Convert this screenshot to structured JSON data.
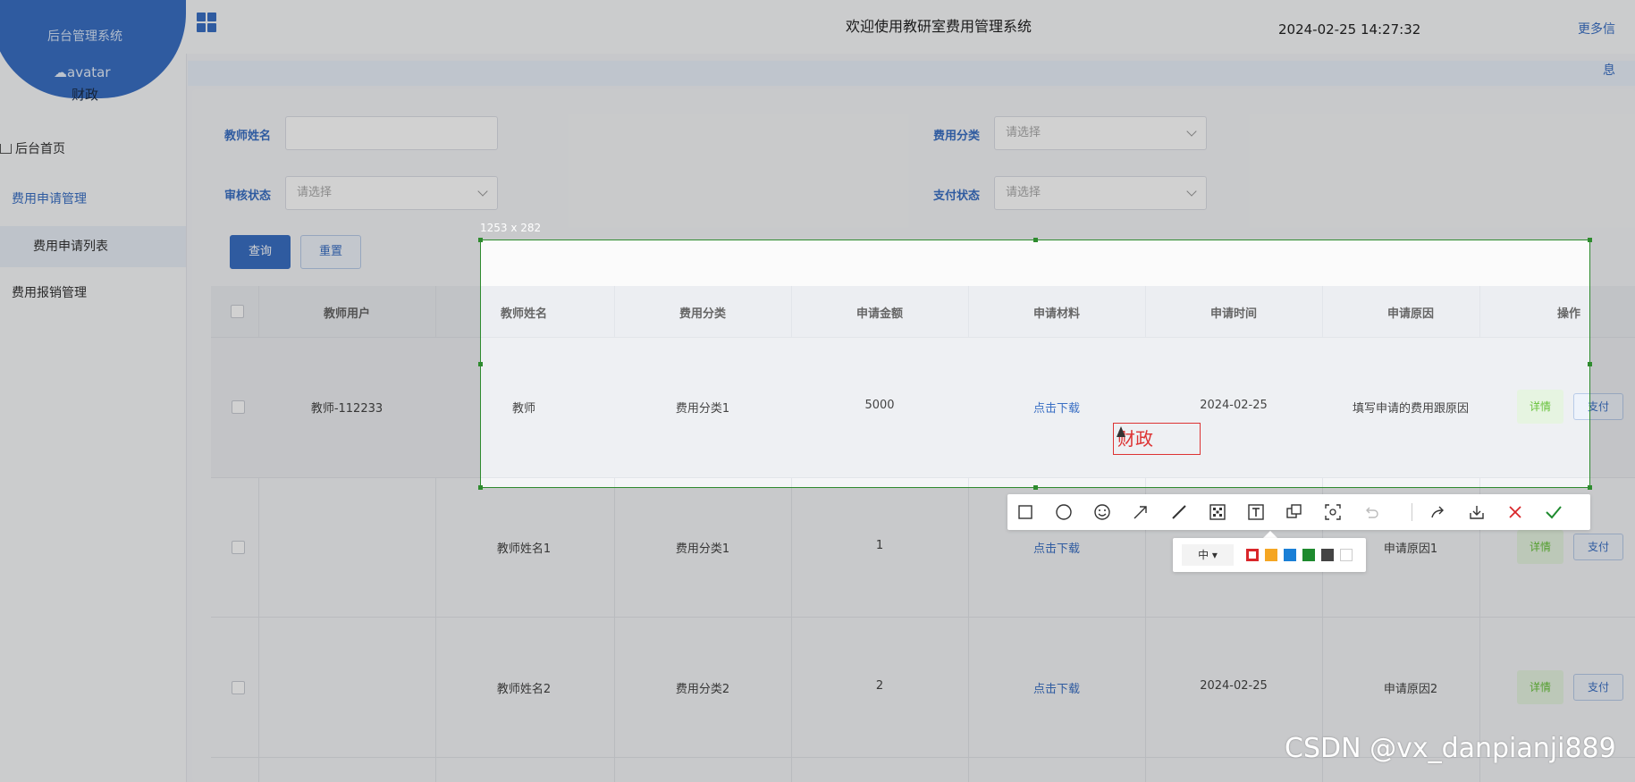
{
  "sidebar": {
    "brand_title": "后台管理系统",
    "avatar_alt": "avatar",
    "user_name": "财政",
    "items": [
      {
        "label": "后台首页"
      },
      {
        "label": "费用申请管理"
      },
      {
        "label": "费用申请列表"
      },
      {
        "label": "费用报销管理"
      }
    ]
  },
  "header": {
    "title": "欢迎使用教研室费用管理系统",
    "datetime": "2024-02-25 14:27:32",
    "more": "更多信",
    "info": "息"
  },
  "filters": {
    "teacher_name_label": "教师姓名",
    "fee_category_label": "费用分类",
    "fee_category_placeholder": "请选择",
    "audit_status_label": "审核状态",
    "audit_status_placeholder": "请选择",
    "pay_status_label": "支付状态",
    "pay_status_placeholder": "请选择",
    "query_label": "查询",
    "reset_label": "重置"
  },
  "table": {
    "columns": [
      "教师用户",
      "教师姓名",
      "费用分类",
      "申请金额",
      "申请材料",
      "申请时间",
      "申请原因",
      "操作"
    ],
    "rows": [
      {
        "user": "教师-112233",
        "name": "教师",
        "category": "费用分类1",
        "amount": "5000",
        "material": "点击下载",
        "time": "2024-02-25",
        "reason": "填写申请的费用跟原因"
      },
      {
        "user": "",
        "name": "教师姓名1",
        "category": "费用分类1",
        "amount": "1",
        "material": "点击下载",
        "time": "",
        "reason": "申请原因1"
      },
      {
        "user": "",
        "name": "教师姓名2",
        "category": "费用分类2",
        "amount": "2",
        "material": "点击下载",
        "time": "2024-02-25",
        "reason": "申请原因2"
      }
    ],
    "detail_label": "详情",
    "pay_label": "支付"
  },
  "capture": {
    "size_label": "1253 x 282",
    "text_annotation": "财政",
    "size_option": "中",
    "colors": [
      "#d9262a",
      "#f5a623",
      "#1a7fd6",
      "#1e8a2e",
      "#444444",
      "#ffffff"
    ],
    "tools": [
      "rect-icon",
      "ellipse-icon",
      "emoji-icon",
      "arrow-icon",
      "pen-icon",
      "mosaic-icon",
      "text-icon",
      "pin-icon",
      "ocr-icon",
      "undo-icon",
      "share-icon",
      "save-icon",
      "cancel-icon",
      "confirm-icon"
    ]
  },
  "watermark": "CSDN @vx_danpianji889"
}
